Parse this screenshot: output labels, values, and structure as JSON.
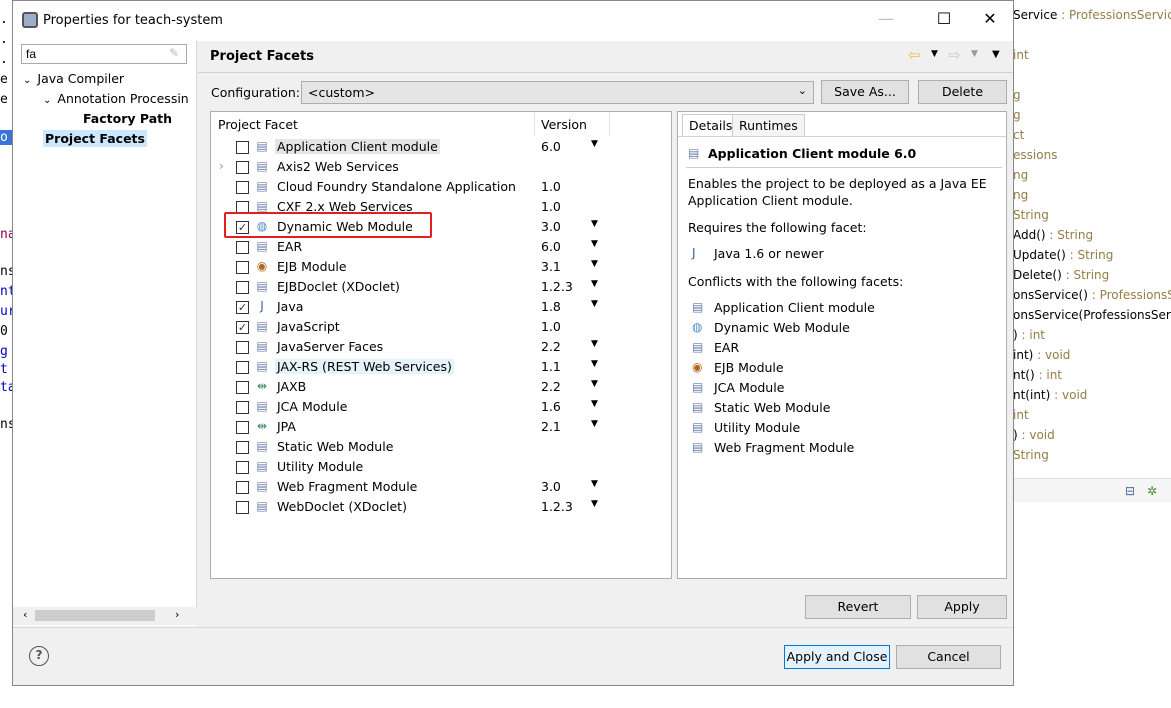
{
  "background_left": {
    "lines": [
      ".",
      ".",
      ".",
      "e",
      "e",
      "o",
      "na",
      "ns",
      "nt",
      "ur",
      "0",
      "g",
      "t",
      "ta",
      "ns"
    ]
  },
  "background_right": {
    "outline": [
      {
        "name": "Service",
        "type": " : ProfessionsService"
      },
      {
        "name": "",
        "type": "int"
      },
      {
        "name": "",
        "type": "g"
      },
      {
        "name": "",
        "type": "g"
      },
      {
        "name": "",
        "type": "ct"
      },
      {
        "name": "",
        "type": "essions"
      },
      {
        "name": "",
        "type": "ng"
      },
      {
        "name": "",
        "type": "ng"
      },
      {
        "name": "",
        "type": " String"
      },
      {
        "name": "Add()",
        "type": " : String"
      },
      {
        "name": "Update()",
        "type": " : String"
      },
      {
        "name": "Delete()",
        "type": " : String"
      },
      {
        "name": "onsService()",
        "type": " : ProfessionsSe"
      },
      {
        "name": "onsService(ProfessionsServi",
        "type": ""
      },
      {
        "name": ")",
        "type": " : int"
      },
      {
        "name": "int)",
        "type": " : void"
      },
      {
        "name": "nt()",
        "type": " : int"
      },
      {
        "name": "nt(int)",
        "type": " : void"
      },
      {
        "name": "",
        "type": " int"
      },
      {
        "name": ")",
        "type": " : void"
      },
      {
        "name": "",
        "type": "String"
      }
    ]
  },
  "dialog": {
    "title": "Properties for teach-system",
    "filter_value": "fa",
    "tree": [
      {
        "label": "Java Compiler",
        "expanded": true,
        "level": 0,
        "bold": false
      },
      {
        "label": "Annotation Processin",
        "expanded": true,
        "level": 1,
        "bold": false
      },
      {
        "label": "Factory Path",
        "level": 2,
        "bold": true
      },
      {
        "label": "Project Facets",
        "level": 0,
        "bold": true,
        "selected": true
      }
    ],
    "page_title": "Project Facets",
    "configuration_label": "Configuration:",
    "configuration_value": "<custom>",
    "save_as_label": "Save As...",
    "delete_label": "Delete",
    "facet_columns": {
      "facet": "Project Facet",
      "version": "Version"
    },
    "facets": [
      {
        "name": "Application Client module",
        "version": "6.0",
        "checked": false,
        "dropdown": true,
        "icon": "document-icon"
      },
      {
        "name": "Axis2 Web Services",
        "version": "",
        "checked": false,
        "dropdown": false,
        "icon": "document-icon",
        "expandable": true
      },
      {
        "name": "Cloud Foundry Standalone Application",
        "version": "1.0",
        "checked": false,
        "dropdown": false,
        "icon": "document-icon"
      },
      {
        "name": "CXF 2.x Web Services",
        "version": "1.0",
        "checked": false,
        "dropdown": false,
        "icon": "document-icon"
      },
      {
        "name": "Dynamic Web Module",
        "version": "3.0",
        "checked": true,
        "dropdown": true,
        "icon": "web-module-icon"
      },
      {
        "name": "EAR",
        "version": "6.0",
        "checked": false,
        "dropdown": true,
        "icon": "document-icon"
      },
      {
        "name": "EJB Module",
        "version": "3.1",
        "checked": false,
        "dropdown": true,
        "icon": "ejb-icon"
      },
      {
        "name": "EJBDoclet (XDoclet)",
        "version": "1.2.3",
        "checked": false,
        "dropdown": true,
        "icon": "document-icon"
      },
      {
        "name": "Java",
        "version": "1.8",
        "checked": true,
        "dropdown": true,
        "icon": "java-icon"
      },
      {
        "name": "JavaScript",
        "version": "1.0",
        "checked": true,
        "dropdown": false,
        "icon": "document-icon"
      },
      {
        "name": "JavaServer Faces",
        "version": "2.2",
        "checked": false,
        "dropdown": true,
        "icon": "document-icon"
      },
      {
        "name": "JAX-RS (REST Web Services)",
        "version": "1.1",
        "checked": false,
        "dropdown": true,
        "icon": "document-icon",
        "hover": true
      },
      {
        "name": "JAXB",
        "version": "2.2",
        "checked": false,
        "dropdown": true,
        "icon": "arrows-icon"
      },
      {
        "name": "JCA Module",
        "version": "1.6",
        "checked": false,
        "dropdown": true,
        "icon": "document-icon"
      },
      {
        "name": "JPA",
        "version": "2.1",
        "checked": false,
        "dropdown": true,
        "icon": "arrows-icon"
      },
      {
        "name": "Static Web Module",
        "version": "",
        "checked": false,
        "dropdown": false,
        "icon": "document-icon"
      },
      {
        "name": "Utility Module",
        "version": "",
        "checked": false,
        "dropdown": false,
        "icon": "document-icon"
      },
      {
        "name": "Web Fragment Module",
        "version": "3.0",
        "checked": false,
        "dropdown": true,
        "icon": "document-icon"
      },
      {
        "name": "WebDoclet (XDoclet)",
        "version": "1.2.3",
        "checked": false,
        "dropdown": true,
        "icon": "document-icon"
      }
    ],
    "details_tabs": [
      "Details",
      "Runtimes"
    ],
    "details": {
      "heading": "Application Client module 6.0",
      "description_lines": [
        "Enables the project to be deployed as a Java EE",
        "Application Client module."
      ],
      "requires_label": "Requires the following facet:",
      "requires": [
        "Java 1.6 or newer"
      ],
      "conflicts_label": "Conflicts with the following facets:",
      "conflicts": [
        "Application Client module",
        "Dynamic Web Module",
        "EAR",
        "EJB Module",
        "JCA Module",
        "Static Web Module",
        "Utility Module",
        "Web Fragment Module"
      ]
    },
    "revert_label": "Revert",
    "apply_label": "Apply",
    "apply_close_label": "Apply and Close",
    "cancel_label": "Cancel",
    "highlight_color": "#e0201c"
  }
}
